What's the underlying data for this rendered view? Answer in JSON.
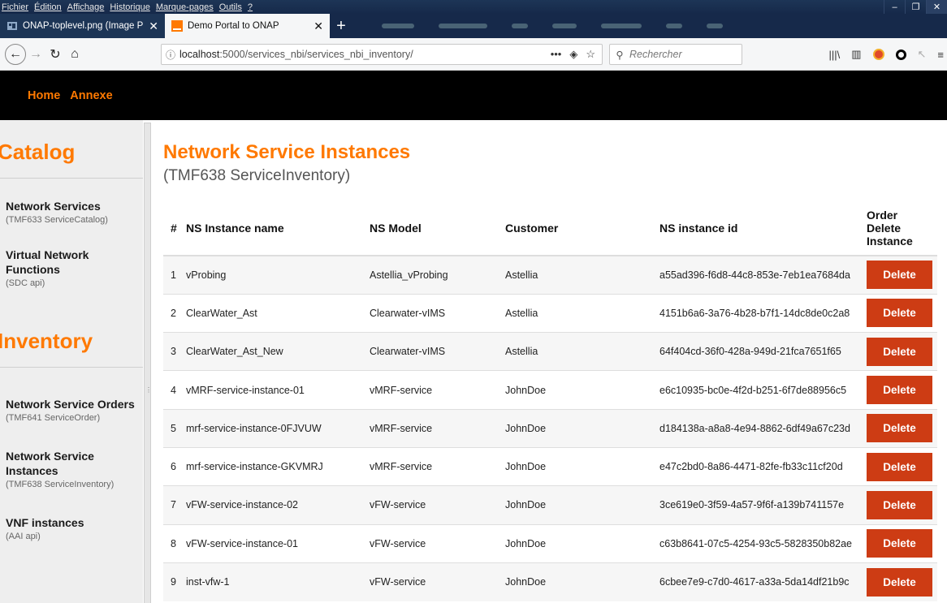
{
  "browser": {
    "menu": [
      "Fichier",
      "Édition",
      "Affichage",
      "Historique",
      "Marque-pages",
      "Outils",
      "?"
    ],
    "tabs": [
      {
        "label": "ONAP-toplevel.png (Image PN",
        "active": false
      },
      {
        "label": "Demo Portal to ONAP",
        "active": true
      }
    ],
    "url_host": "localhost",
    "url_path": ":5000/services_nbi/services_nbi_inventory/",
    "search_placeholder": "Rechercher"
  },
  "header": {
    "links": [
      "Home",
      "Annexe"
    ]
  },
  "sidebar": {
    "sections": [
      {
        "title": "Catalog",
        "items": [
          {
            "label": "Network Services",
            "sub": "(TMF633 ServiceCatalog)"
          },
          {
            "label": "Virtual Network Functions",
            "sub": "(SDC api)"
          }
        ]
      },
      {
        "title": "Inventory",
        "items": [
          {
            "label": "Network Service Orders",
            "sub": "(TMF641 ServiceOrder)"
          },
          {
            "label": "Network Service Instances",
            "sub": "(TMF638 ServiceInventory)"
          },
          {
            "label": "VNF instances",
            "sub": "(AAI api)"
          }
        ]
      }
    ]
  },
  "main": {
    "title": "Network Service Instances",
    "subtitle": "(TMF638 ServiceInventory)",
    "table": {
      "headers": {
        "num": "#",
        "name": "NS Instance name",
        "model": "NS Model",
        "customer": "Customer",
        "id": "NS instance id",
        "action_line1": "Order",
        "action_line2": "Delete",
        "action_line3": "Instance"
      },
      "delete_label": "Delete",
      "rows": [
        {
          "num": "1",
          "name": "vProbing",
          "model": "Astellia_vProbing",
          "customer": "Astellia",
          "id": "a55ad396-f6d8-44c8-853e-7eb1ea7684da"
        },
        {
          "num": "2",
          "name": "ClearWater_Ast",
          "model": "Clearwater-vIMS",
          "customer": "Astellia",
          "id": "4151b6a6-3a76-4b28-b7f1-14dc8de0c2a8"
        },
        {
          "num": "3",
          "name": "ClearWater_Ast_New",
          "model": "Clearwater-vIMS",
          "customer": "Astellia",
          "id": "64f404cd-36f0-428a-949d-21fca7651f65"
        },
        {
          "num": "4",
          "name": "vMRF-service-instance-01",
          "model": "vMRF-service",
          "customer": "JohnDoe",
          "id": "e6c10935-bc0e-4f2d-b251-6f7de88956c5"
        },
        {
          "num": "5",
          "name": "mrf-service-instance-0FJVUW",
          "model": "vMRF-service",
          "customer": "JohnDoe",
          "id": "d184138a-a8a8-4e94-8862-6df49a67c23d"
        },
        {
          "num": "6",
          "name": "mrf-service-instance-GKVMRJ",
          "model": "vMRF-service",
          "customer": "JohnDoe",
          "id": "e47c2bd0-8a86-4471-82fe-fb33c11cf20d"
        },
        {
          "num": "7",
          "name": "vFW-service-instance-02",
          "model": "vFW-service",
          "customer": "JohnDoe",
          "id": "3ce619e0-3f59-4a57-9f6f-a139b741157e"
        },
        {
          "num": "8",
          "name": "vFW-service-instance-01",
          "model": "vFW-service",
          "customer": "JohnDoe",
          "id": "c63b8641-07c5-4254-93c5-5828350b82ae"
        },
        {
          "num": "9",
          "name": "inst-vfw-1",
          "model": "vFW-service",
          "customer": "JohnDoe",
          "id": "6cbee7e9-c7d0-4617-a33a-5da14df21b9c"
        }
      ]
    }
  },
  "colors": {
    "accent": "#ff7900",
    "delete_button": "#cd3c14",
    "header_bg": "#000000",
    "sidebar_bg": "#eeeeee"
  }
}
